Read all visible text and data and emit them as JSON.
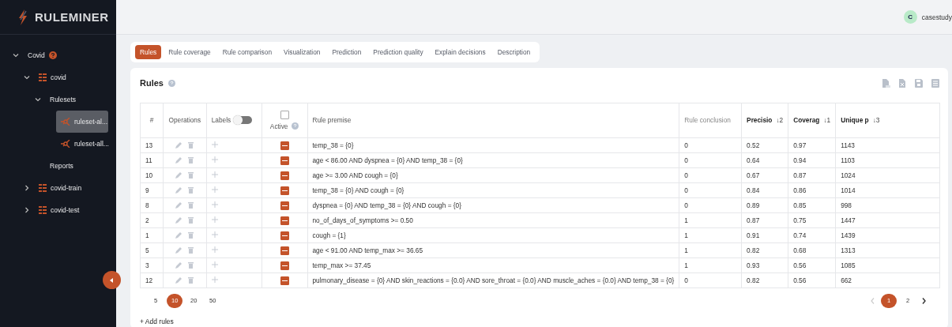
{
  "app": {
    "name": "RULEMINER"
  },
  "user": {
    "initial": "C",
    "name": "casestudy"
  },
  "tree": [
    {
      "label": "Covid",
      "expanded": true,
      "help": true,
      "selected": false,
      "children": [
        {
          "label": "covid",
          "kind": "dataset",
          "expanded": true,
          "selected": false,
          "children": [
            {
              "label": "Rulesets",
              "expanded": true,
              "selected": false,
              "children": [
                {
                  "label": "ruleset-al...",
                  "kind": "ruleset",
                  "selected": true
                },
                {
                  "label": "ruleset-all...",
                  "kind": "ruleset",
                  "selected": false
                }
              ]
            },
            {
              "label": "Reports",
              "selected": false
            }
          ]
        },
        {
          "label": "covid-train",
          "kind": "dataset",
          "expanded": false,
          "selected": false
        },
        {
          "label": "covid-test",
          "kind": "dataset",
          "expanded": false,
          "selected": false
        }
      ]
    }
  ],
  "tabs": [
    {
      "label": "Rules",
      "selected": true
    },
    {
      "label": "Rule coverage",
      "selected": false
    },
    {
      "label": "Rule comparison",
      "selected": false
    },
    {
      "label": "Visualization",
      "selected": false
    },
    {
      "label": "Prediction",
      "selected": false
    },
    {
      "label": "Prediction quality",
      "selected": false
    },
    {
      "label": "Explain decisions",
      "selected": false
    },
    {
      "label": "Description",
      "selected": false
    }
  ],
  "panel": {
    "title": "Rules",
    "table": {
      "columns": [
        {
          "kind": "number",
          "label": "#"
        },
        {
          "kind": "operations",
          "label": "Operations"
        },
        {
          "kind": "labels",
          "label": "Labels",
          "on": false
        },
        {
          "kind": "active",
          "label": "Active",
          "checked": false
        },
        {
          "kind": "premise",
          "label": "Rule premise"
        },
        {
          "kind": "conclusion",
          "label": "Rule conclusion"
        },
        {
          "kind": "precision",
          "label": "Precisio",
          "sort": "↓2"
        },
        {
          "kind": "coverage",
          "label": "Coverag",
          "sort": "↓1"
        },
        {
          "kind": "unique",
          "label": "Unique p",
          "sort": "↓3"
        }
      ],
      "rows": [
        {
          "number": "13",
          "active": true,
          "premise": "temp_38 = {0}",
          "conclusion": "0",
          "precision": "0.52",
          "coverage": "0.97",
          "unique": "1143"
        },
        {
          "number": "11",
          "active": true,
          "premise": "age < 86.00 AND dyspnea = {0} AND temp_38 = {0}",
          "conclusion": "0",
          "precision": "0.64",
          "coverage": "0.94",
          "unique": "1103"
        },
        {
          "number": "10",
          "active": true,
          "premise": "age >= 3.00 AND cough = {0}",
          "conclusion": "0",
          "precision": "0.67",
          "coverage": "0.87",
          "unique": "1024"
        },
        {
          "number": "9",
          "active": true,
          "premise": "temp_38 = {0} AND cough = {0}",
          "conclusion": "0",
          "precision": "0.84",
          "coverage": "0.86",
          "unique": "1014"
        },
        {
          "number": "8",
          "active": true,
          "premise": "dyspnea = {0} AND temp_38 = {0} AND cough = {0}",
          "conclusion": "0",
          "precision": "0.89",
          "coverage": "0.85",
          "unique": "998"
        },
        {
          "number": "2",
          "active": true,
          "premise": "no_of_days_of_symptoms >= 0.50",
          "conclusion": "1",
          "precision": "0.87",
          "coverage": "0.75",
          "unique": "1447"
        },
        {
          "number": "1",
          "active": true,
          "premise": "cough = {1}",
          "conclusion": "1",
          "precision": "0.91",
          "coverage": "0.74",
          "unique": "1439"
        },
        {
          "number": "5",
          "active": true,
          "premise": "age < 91.00 AND temp_max >= 36.65",
          "conclusion": "1",
          "precision": "0.82",
          "coverage": "0.68",
          "unique": "1313"
        },
        {
          "number": "3",
          "active": true,
          "premise": "temp_max >= 37.45",
          "conclusion": "1",
          "precision": "0.93",
          "coverage": "0.56",
          "unique": "1085"
        },
        {
          "number": "12",
          "active": true,
          "premise": "pulmonary_disease = {0} AND skin_reactions = {0.0} AND sore_throat = {0.0} AND muscle_aches = {0.0} AND temp_38 = {0}",
          "conclusion": "0",
          "precision": "0.82",
          "coverage": "0.56",
          "unique": "662"
        }
      ]
    },
    "page_sizes": [
      {
        "label": "5",
        "selected": false
      },
      {
        "label": "10",
        "selected": true
      },
      {
        "label": "20",
        "selected": false
      },
      {
        "label": "50",
        "selected": false
      }
    ],
    "pages": [
      {
        "label": "1",
        "selected": true
      },
      {
        "label": "2",
        "selected": false
      }
    ],
    "add_button": "+ Add rules"
  }
}
